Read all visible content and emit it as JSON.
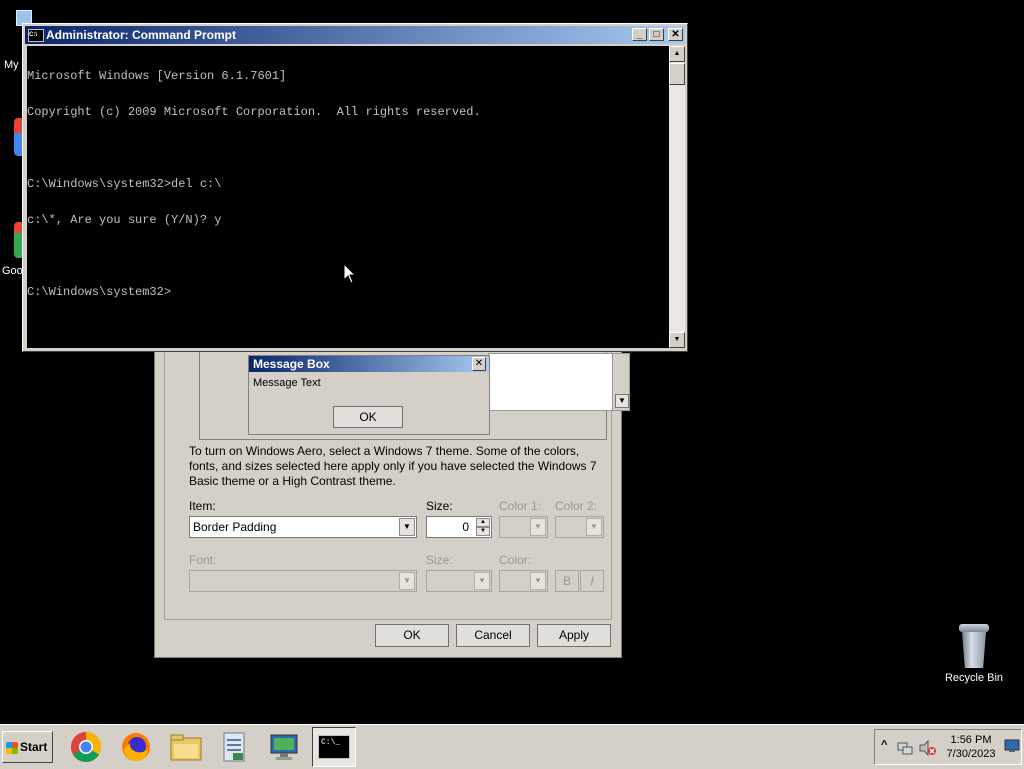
{
  "desktop": {
    "icons": [
      {
        "label": "Recycle Bin",
        "icon": "recycle-bin-icon"
      },
      {
        "label": "My",
        "icon": "computer-icon"
      },
      {
        "label": "Goo",
        "icon": "chrome-icon"
      }
    ]
  },
  "cmd_window": {
    "title": "Administrator: Command Prompt",
    "controls": {
      "minimize": "_",
      "maximize": "□",
      "close": "✕"
    },
    "lines": [
      "Microsoft Windows [Version 6.1.7601]",
      "Copyright (c) 2009 Microsoft Corporation.  All rights reserved.",
      "",
      "C:\\Windows\\system32>del c:\\",
      "c:\\*, Are you sure (Y/N)? y",
      "",
      "C:\\Windows\\system32>"
    ]
  },
  "appearance_dialog": {
    "preview_msgbox": {
      "title": "Message Box",
      "text": "Message Text",
      "ok": "OK",
      "close": "✕"
    },
    "help_text": "To turn on Windows Aero, select a Windows 7 theme.  Some of the colors, fonts, and sizes selected here apply only if you have selected the Windows 7 Basic theme or a High Contrast theme.",
    "item_label": "Item:",
    "item_value": "Border Padding",
    "size_label": "Size:",
    "size_value": "0",
    "color1_label": "Color 1:",
    "color2_label": "Color 2:",
    "font_label": "Font:",
    "font_size_label": "Size:",
    "font_color_label": "Color:",
    "bold_label": "B",
    "italic_label": "I",
    "ok": "OK",
    "cancel": "Cancel",
    "apply": "Apply"
  },
  "taskbar": {
    "start_label": "Start",
    "apps": [
      {
        "name": "chrome-icon"
      },
      {
        "name": "firefox-icon"
      },
      {
        "name": "file-explorer-icon"
      },
      {
        "name": "notepad-file-icon"
      },
      {
        "name": "remote-desktop-icon"
      },
      {
        "name": "command-prompt-icon",
        "label": "C:\\_"
      }
    ],
    "tray": {
      "time": "1:56 PM",
      "date": "7/30/2023",
      "chevron": "^"
    }
  }
}
